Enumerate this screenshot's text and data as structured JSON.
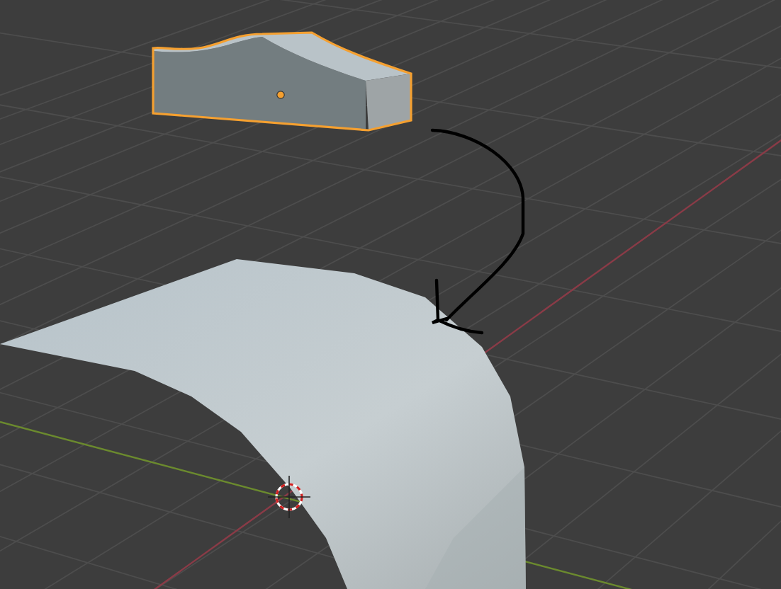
{
  "viewport": {
    "kind": "viewport",
    "grid": true,
    "objects": [
      {
        "kind": "extruded-block",
        "selected": true
      },
      {
        "kind": "curved-surface",
        "selected": false
      }
    ],
    "annotation": {
      "kind": "hand-drawn-arrow"
    },
    "cursor": {
      "kind": "crosshair"
    }
  }
}
